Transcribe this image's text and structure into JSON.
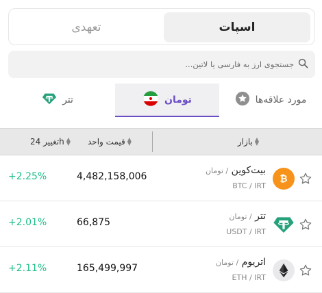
{
  "segment": {
    "spot": "اسپات",
    "commitment": "تعهدی"
  },
  "search": {
    "placeholder": "جستجوی ارز به فارسی یا لاتین..."
  },
  "tabs": {
    "favorites": "مورد علاقه‌ها",
    "toman": "تومان",
    "tether": "تتر"
  },
  "table": {
    "market": "بازار",
    "unit_price": "قیمت واحد",
    "change": "تغییر 24h"
  },
  "rows": [
    {
      "name": "بیت‌کوین",
      "quote": "/ تومان",
      "pair": "BTC / IRT",
      "price": "4,482,158,006",
      "change": "+2.25%",
      "icon": "bitcoin-icon"
    },
    {
      "name": "تتر",
      "quote": "/ تومان",
      "pair": "USDT / IRT",
      "price": "66,875",
      "change": "+2.01%",
      "icon": "tether-icon"
    },
    {
      "name": "اتریوم",
      "quote": "/ تومان",
      "pair": "ETH / IRT",
      "price": "165,499,997",
      "change": "+2.11%",
      "icon": "ethereum-icon"
    }
  ],
  "colors": {
    "accent": "#6c4dc4",
    "positive": "#1cbf8b",
    "bitcoin": "#f7931a",
    "tether": "#26a17b",
    "ethereum": "#6b6b6b"
  }
}
